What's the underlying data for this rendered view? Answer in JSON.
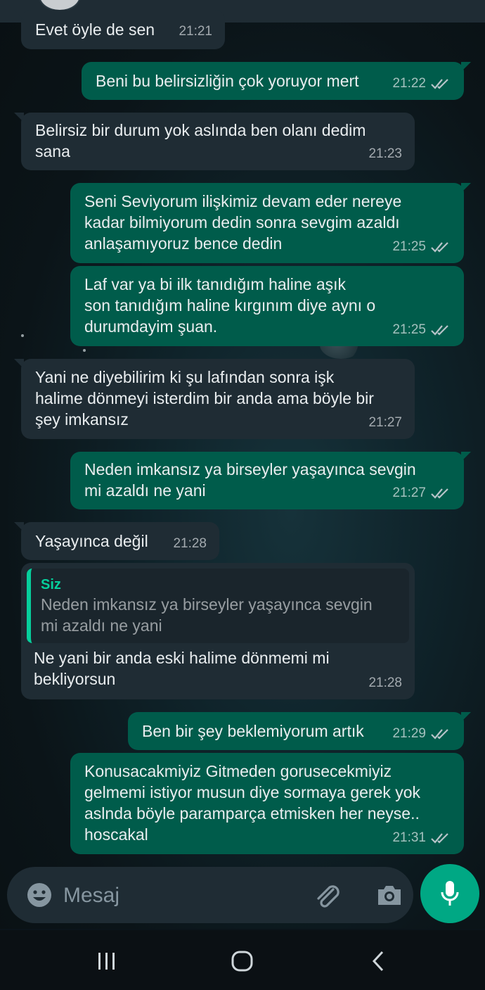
{
  "messages": [
    {
      "dir": "in",
      "text": "Evet öyle de sen",
      "time": "21:21"
    },
    {
      "dir": "out",
      "text": "Beni bu belirsizliğin çok yoruyor mert",
      "time": "21:22"
    },
    {
      "dir": "in",
      "text": "Belirsiz bir durum yok aslında ben olanı dedim\nsana",
      "time": "21:23"
    },
    {
      "dir": "out",
      "text": "Seni Seviyorum ilişkimiz devam eder nereye\nkadar bilmiyorum dedin sonra sevgim azaldı\nanlaşamıyoruz bence dedin",
      "time": "21:25"
    },
    {
      "dir": "out",
      "text": "Laf var ya bi ilk tanıdığım haline aşık\nson tanıdığım haline kırgınım diye aynı o\ndurumdayim şuan.",
      "time": "21:25"
    },
    {
      "dir": "in",
      "text": "Yani ne diyebilirim ki şu lafından sonra işk\nhalime dönmeyi isterdim bir anda ama böyle bir\nşey imkansız",
      "time": "21:27"
    },
    {
      "dir": "out",
      "text": "Neden imkansız ya birseyler yaşayınca sevgin\nmi azaldı ne yani",
      "time": "21:27"
    },
    {
      "dir": "in",
      "text": "Yaşayınca değil",
      "time": "21:28"
    },
    {
      "dir": "in",
      "text": "Ne yani bir anda eski halime dönmemi mi\nbekliyorsun",
      "time": "21:28",
      "reply": {
        "author": "Siz",
        "text": "Neden imkansız ya birseyler yaşayınca sevgin\nmi azaldı ne yani"
      }
    },
    {
      "dir": "out",
      "text": "Ben bir şey beklemiyorum artık",
      "time": "21:29"
    },
    {
      "dir": "out",
      "text": "Konusacakmiyiz Gitmeden gorusecekmiyiz\ngelmemi istiyor musun diye sormaya gerek yok\naslnda böyle paramparça etmisken her neyse..\nhoscakal",
      "time": "21:31"
    }
  ],
  "input": {
    "placeholder": "Mesaj"
  },
  "icons": {
    "emoji": "emoji-icon",
    "attach": "paperclip-icon",
    "camera": "camera-icon",
    "mic": "microphone-icon",
    "recents": "recent-apps-icon",
    "home": "home-icon",
    "back": "back-icon"
  },
  "colors": {
    "incoming": "#1f2c34",
    "outgoing": "#005c4b",
    "accent": "#00a884",
    "quote_bar": "#06cf9c"
  }
}
